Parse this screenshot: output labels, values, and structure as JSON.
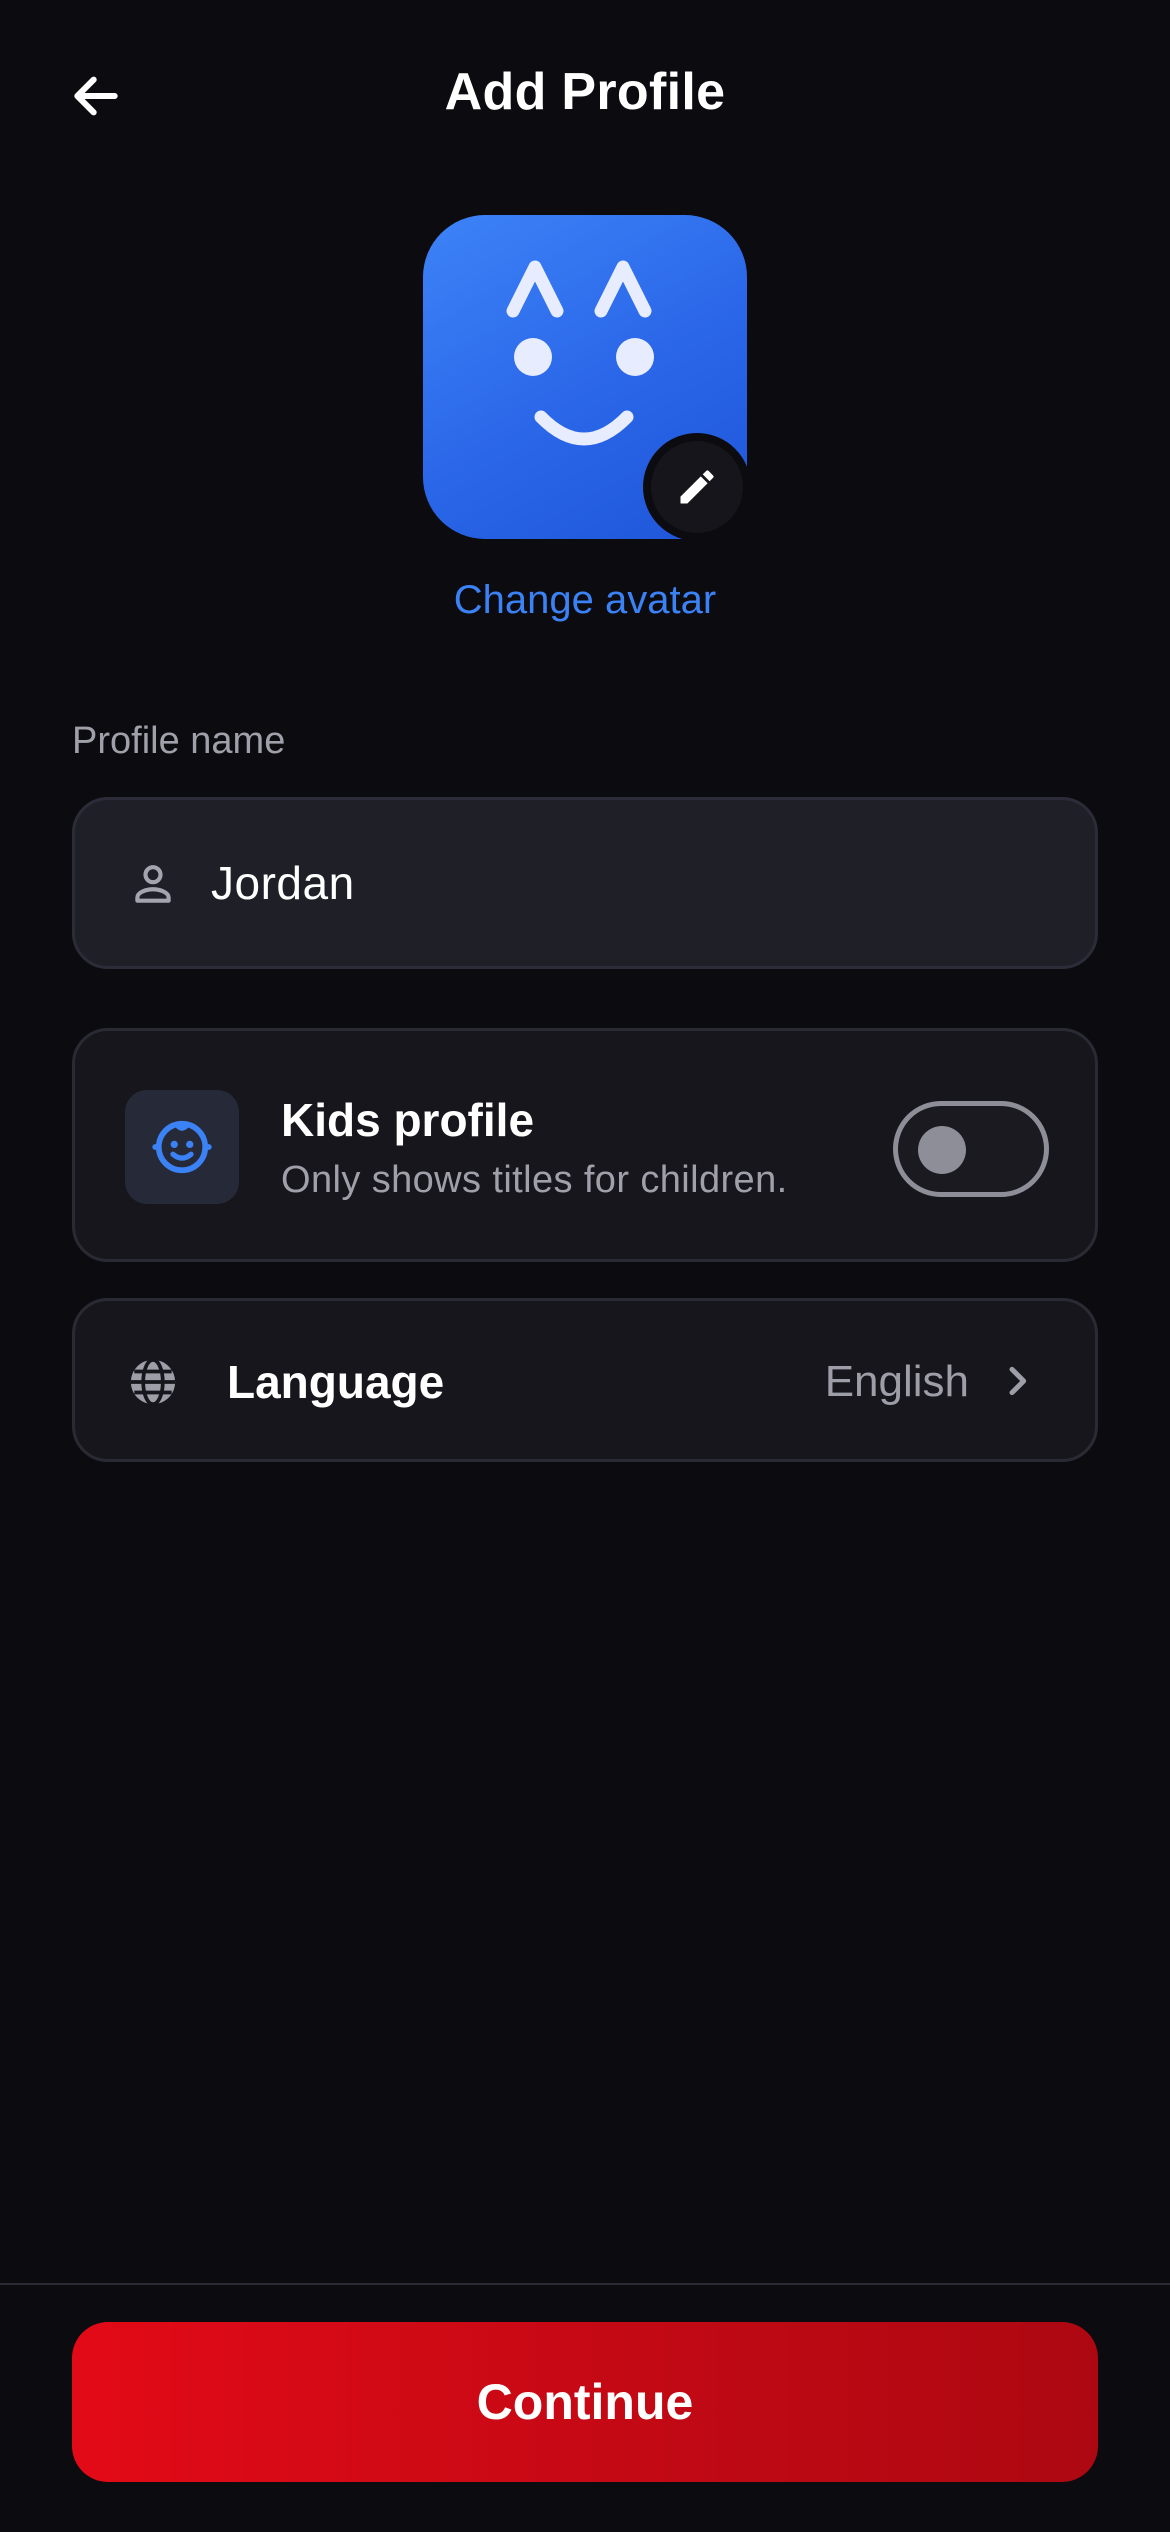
{
  "header": {
    "title": "Add Profile",
    "back_icon": "arrow-left-icon"
  },
  "avatar": {
    "change_label": "Change avatar",
    "edit_icon": "pencil-icon",
    "accent": "#3b82f6"
  },
  "profile_name": {
    "label": "Profile name",
    "value": "Jordan",
    "icon": "person-icon"
  },
  "kids_profile": {
    "title": "Kids profile",
    "subtitle": "Only shows titles for children.",
    "enabled": false,
    "icon": "child-face-icon"
  },
  "language": {
    "label": "Language",
    "value": "English",
    "icon": "globe-icon",
    "chevron": "chevron-right-icon"
  },
  "footer": {
    "continue_label": "Continue",
    "button_color": "#e30a17"
  }
}
